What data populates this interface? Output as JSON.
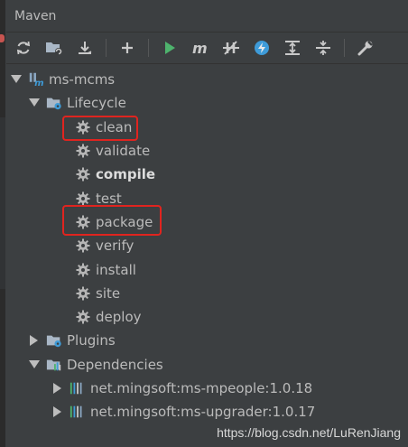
{
  "window": {
    "title": "Maven"
  },
  "toolbar": {
    "icons": [
      "refresh-icon",
      "generate-sources-icon",
      "download-icon",
      "add-icon",
      "run-icon",
      "maven-goal-icon",
      "skip-tests-icon",
      "offline-icon",
      "expand-all-icon",
      "collapse-all-icon",
      "settings-wrench-icon"
    ]
  },
  "tree": {
    "project": "ms-mcms",
    "lifecycle": {
      "label": "Lifecycle",
      "phases": [
        "clean",
        "validate",
        "compile",
        "test",
        "package",
        "verify",
        "install",
        "site",
        "deploy"
      ],
      "bold_phase": "compile",
      "highlighted": [
        "clean",
        "package"
      ]
    },
    "plugins": {
      "label": "Plugins"
    },
    "dependencies": {
      "label": "Dependencies",
      "items": [
        "net.mingsoft:ms-mpeople:1.0.18",
        "net.mingsoft:ms-upgrader:1.0.17"
      ]
    }
  },
  "colors": {
    "highlight": "#e0241f",
    "run": "#4eb36d",
    "accent_blue": "#3e9bd8"
  },
  "watermark": "https://blog.csdn.net/LuRenJiang"
}
